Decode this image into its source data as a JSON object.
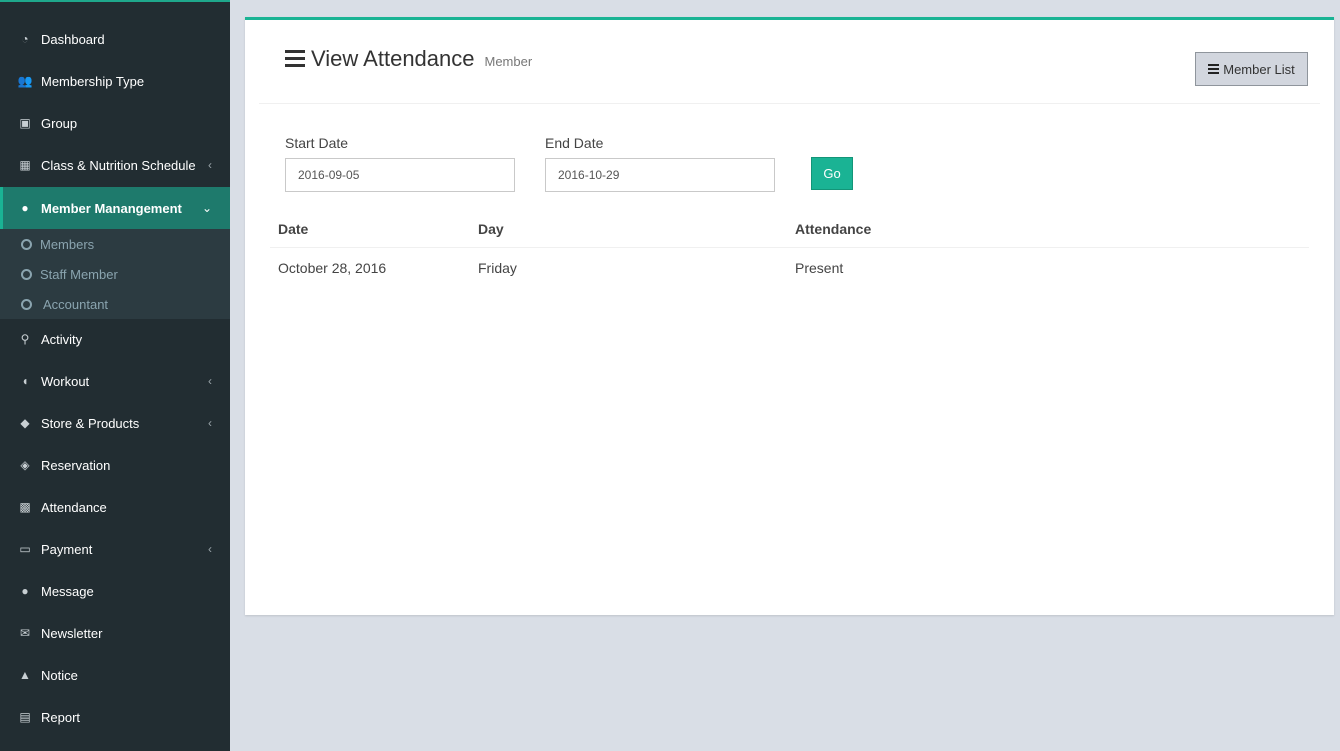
{
  "sidebar": {
    "items": [
      {
        "label": "Dashboard",
        "icon": "dashboard-icon",
        "glyph": "◔"
      },
      {
        "label": "Membership Type",
        "icon": "users-icon",
        "glyph": "👥"
      },
      {
        "label": "Group",
        "icon": "group-icon",
        "glyph": "▣"
      },
      {
        "label": "Class & Nutrition Schedule",
        "icon": "calendar-icon",
        "glyph": "▦"
      },
      {
        "label": "Member Manangement",
        "icon": "user-icon",
        "glyph": "●"
      },
      {
        "label": "Activity",
        "icon": "bicycle-icon",
        "glyph": "⚲"
      },
      {
        "label": "Workout",
        "icon": "workout-icon",
        "glyph": "◖"
      },
      {
        "label": "Store & Products",
        "icon": "tags-icon",
        "glyph": "◆"
      },
      {
        "label": "Reservation",
        "icon": "ticket-icon",
        "glyph": "◈"
      },
      {
        "label": "Attendance",
        "icon": "qrcode-icon",
        "glyph": "▩"
      },
      {
        "label": "Payment",
        "icon": "money-icon",
        "glyph": "▭"
      },
      {
        "label": "Message",
        "icon": "comment-icon",
        "glyph": "●"
      },
      {
        "label": "Newsletter",
        "icon": "envelope-icon",
        "glyph": "✉"
      },
      {
        "label": "Notice",
        "icon": "bell-icon",
        "glyph": "▲"
      },
      {
        "label": "Report",
        "icon": "file-icon",
        "glyph": "▤"
      }
    ],
    "submenu": [
      {
        "label": "Members"
      },
      {
        "label": "Staff Member"
      },
      {
        "label": "Accountant"
      }
    ]
  },
  "header": {
    "title": "View Attendance",
    "subtitle": "Member",
    "member_list_label": "Member List"
  },
  "filters": {
    "start_label": "Start Date",
    "start_value": "2016-09-05",
    "end_label": "End Date",
    "end_value": "2016-10-29",
    "go_label": "Go"
  },
  "table": {
    "columns": [
      "Date",
      "Day",
      "Attendance"
    ],
    "rows": [
      [
        "October 28, 2016",
        "Friday",
        "Present"
      ]
    ]
  },
  "colors": {
    "accent": "#1ab394",
    "sidebar_bg": "#222d32",
    "active_bg": "#1e7a6c"
  }
}
